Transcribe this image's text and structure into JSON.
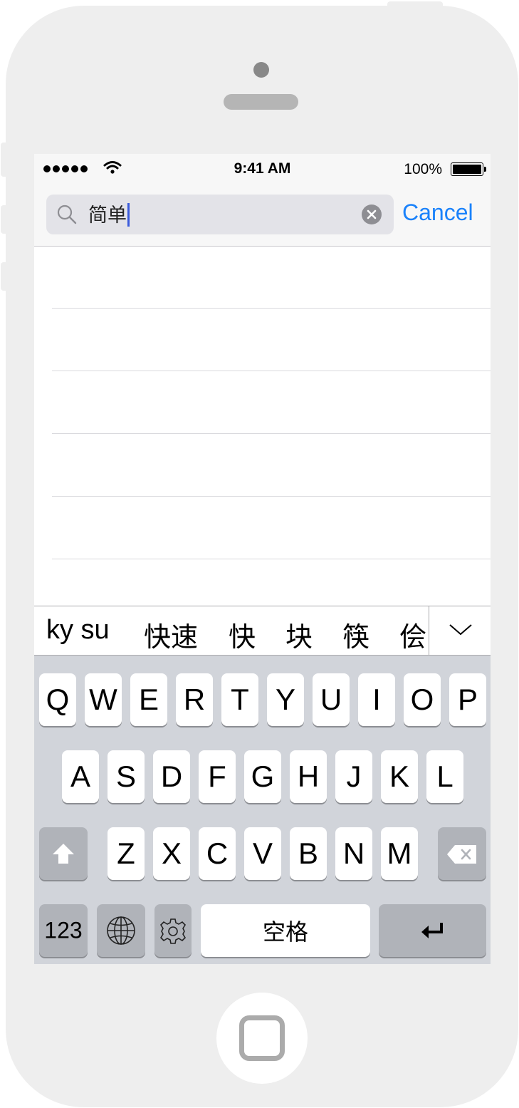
{
  "status_bar": {
    "time": "9:41 AM",
    "battery_percent": "100%",
    "signal_bars": 5,
    "icons": [
      "signal-dots-icon",
      "wifi-icon",
      "battery-icon"
    ]
  },
  "search": {
    "query": "简单",
    "cancel_label": "Cancel",
    "accent_color": "#1a82fb"
  },
  "candidates": {
    "pinyin": "ky su",
    "items": [
      "快速",
      "快",
      "块",
      "筷",
      "侩"
    ]
  },
  "keyboard": {
    "row1": [
      "Q",
      "W",
      "E",
      "R",
      "T",
      "Y",
      "U",
      "I",
      "O",
      "P"
    ],
    "row2": [
      "A",
      "S",
      "D",
      "F",
      "G",
      "H",
      "J",
      "K",
      "L"
    ],
    "row3": [
      "Z",
      "X",
      "C",
      "V",
      "B",
      "N",
      "M"
    ],
    "numbers_label": "123",
    "space_label": "空格"
  }
}
